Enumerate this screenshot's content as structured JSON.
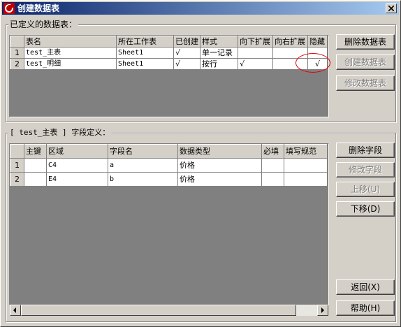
{
  "window": {
    "title": "创建数据表",
    "close_glyph": "✕"
  },
  "defined_tables": {
    "group_label": "已定义的数据表：",
    "columns": [
      "表名",
      "所在工作表",
      "已创建",
      "样式",
      "向下扩展",
      "向右扩展",
      "隐藏"
    ],
    "rows": [
      {
        "num": "1",
        "name": "test_主表",
        "sheet": "Sheet1",
        "created": "√",
        "style": "单一记录",
        "expand_down": "",
        "expand_right": "",
        "hidden": ""
      },
      {
        "num": "2",
        "name": "test_明细",
        "sheet": "Sheet1",
        "created": "√",
        "style": "按行",
        "expand_down": "√",
        "expand_right": "",
        "hidden": "√"
      }
    ],
    "buttons": {
      "delete": "删除数据表",
      "create": "创建数据表",
      "modify": "修改数据表"
    }
  },
  "fields": {
    "group_label": "[ test_主表 ] 字段定义：",
    "columns": [
      "主键",
      "区域",
      "字段名",
      "数据类型",
      "必填",
      "填写规范"
    ],
    "rows": [
      {
        "num": "1",
        "pk": "",
        "area": "C4",
        "field": "a",
        "type": "价格",
        "required": "",
        "rule": ""
      },
      {
        "num": "2",
        "pk": "",
        "area": "E4",
        "field": "b",
        "type": "价格",
        "required": "",
        "rule": ""
      }
    ],
    "buttons": {
      "delete": "删除字段",
      "modify": "修改字段",
      "up": "上移(U)",
      "down": "下移(D)",
      "back": "返回(X)",
      "help": "帮助(H)"
    }
  }
}
